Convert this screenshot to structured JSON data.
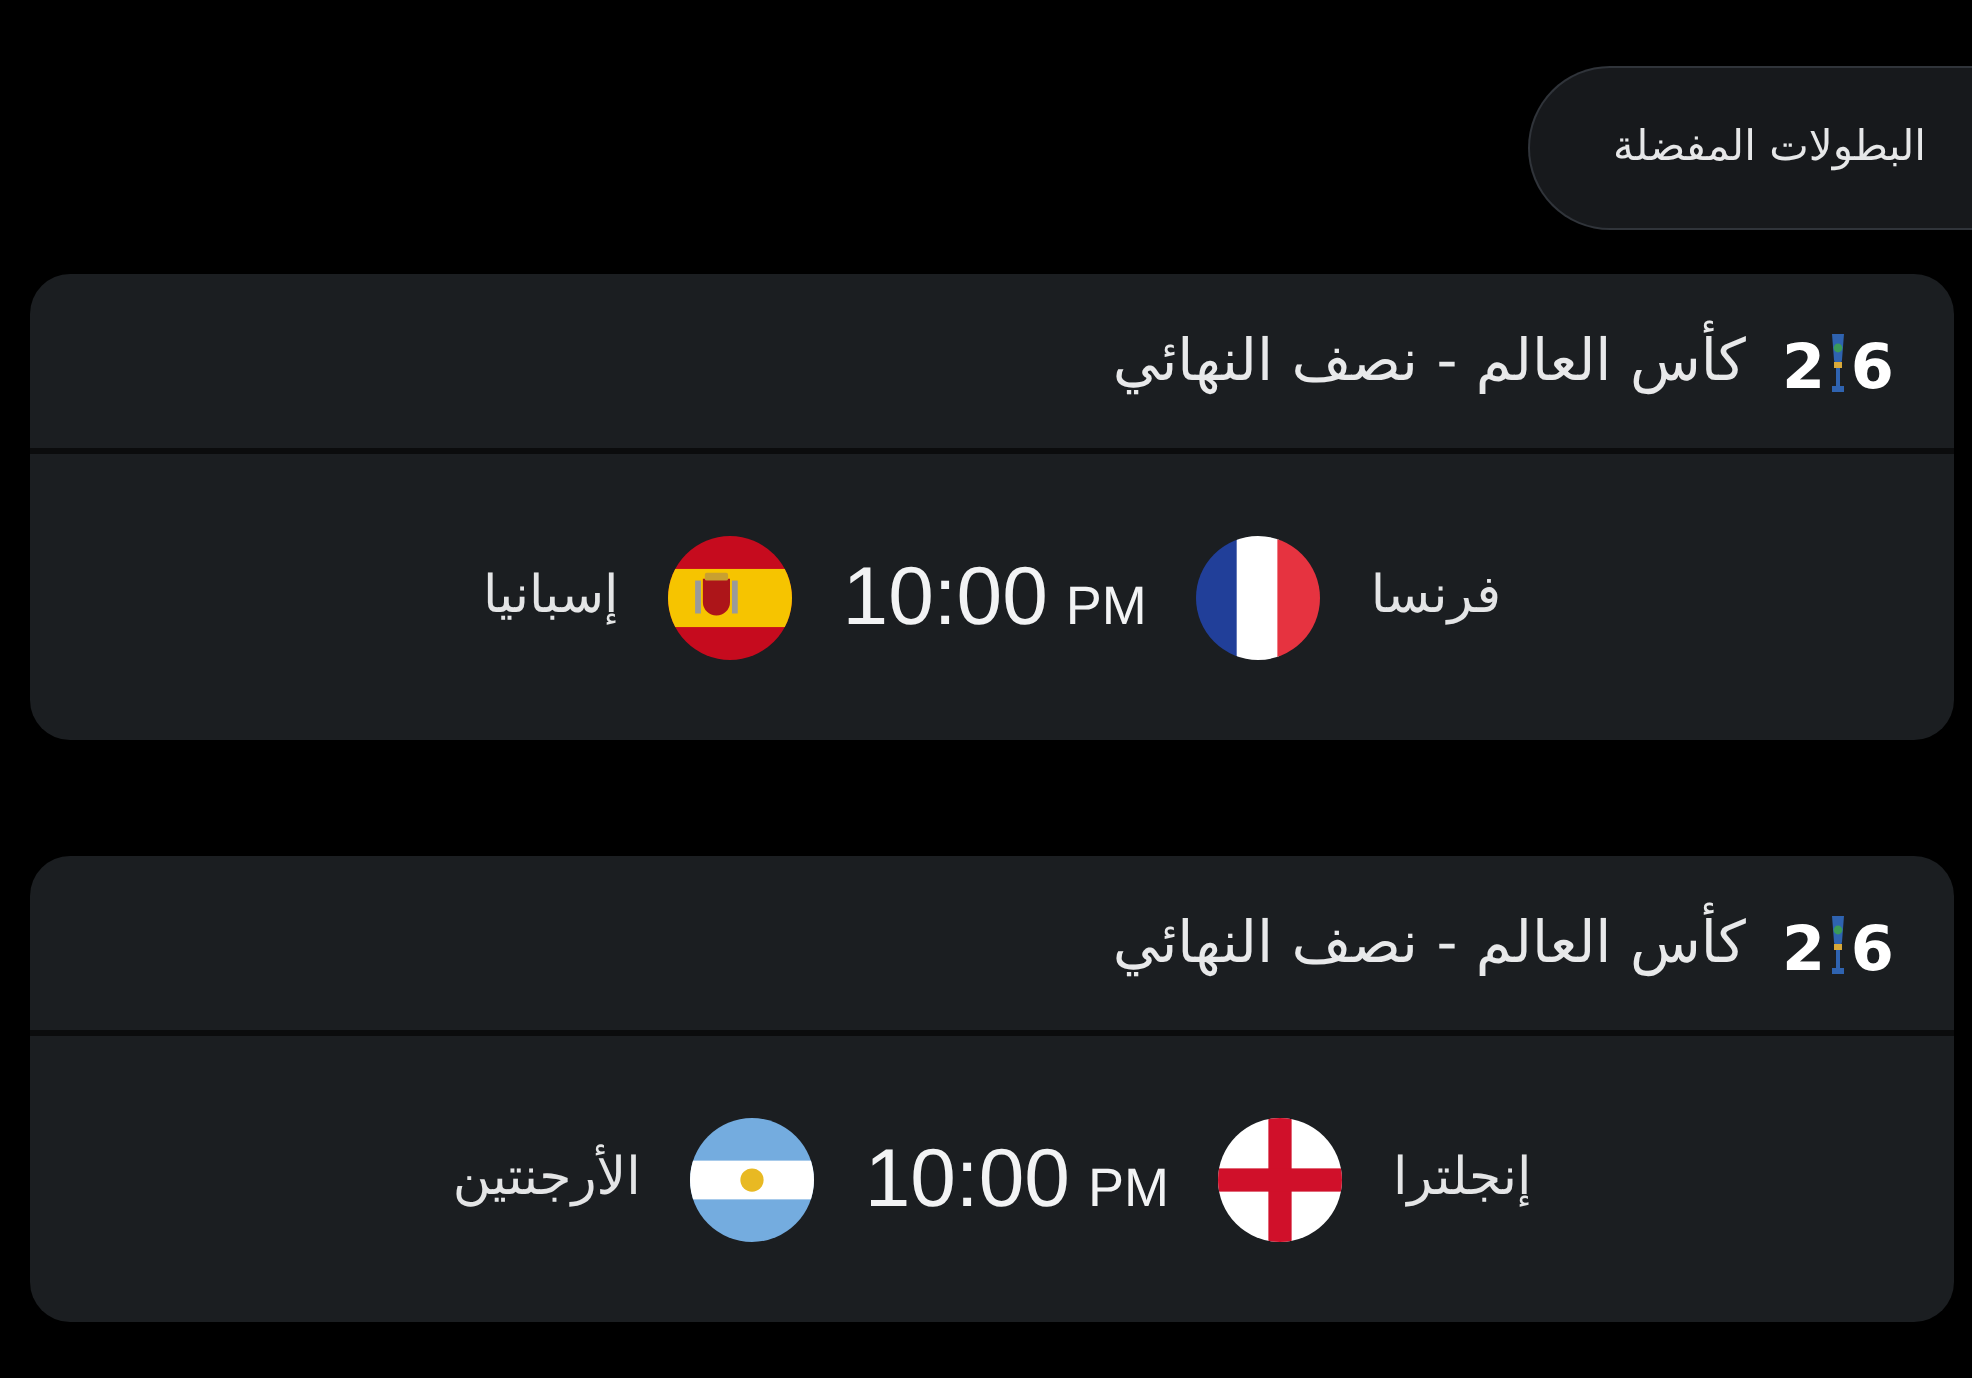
{
  "favorites_button": {
    "label": "البطولات المفضلة"
  },
  "matches": [
    {
      "tournament": {
        "logo_text": "26",
        "title": "كأس العالم - نصف النهائي"
      },
      "home": {
        "name": "فرنسا",
        "kind": "france"
      },
      "time": "10:00",
      "meridiem": "PM",
      "away": {
        "name": "إسبانيا",
        "kind": "spain"
      }
    },
    {
      "tournament": {
        "logo_text": "26",
        "title": "كأس العالم - نصف النهائي"
      },
      "home": {
        "name": "إنجلترا",
        "kind": "england"
      },
      "time": "10:00",
      "meridiem": "PM",
      "away": {
        "name": "الأرجنتين",
        "kind": "argentina"
      }
    }
  ]
}
